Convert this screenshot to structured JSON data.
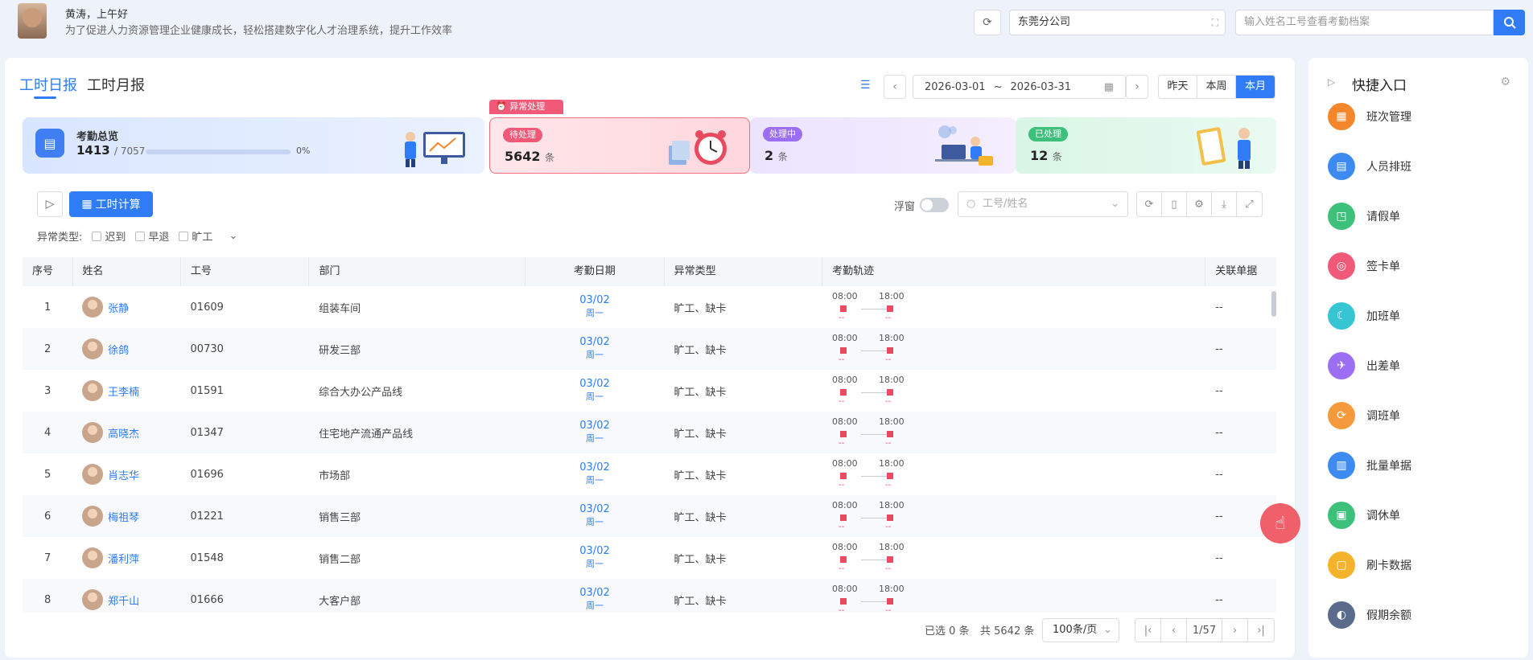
{
  "header": {
    "greeting": "黄涛，上午好",
    "slogan": "为了促进人力资源管理企业健康成长，轻松搭建数字化人才治理系统，提升工作效率",
    "company": "东莞分公司",
    "search_placeholder": "输入姓名工号查看考勤档案"
  },
  "tabs": [
    "工时日报",
    "工时月报"
  ],
  "date": {
    "start": "2026-03-01",
    "sep": "~",
    "end": "2026-03-31",
    "presets": [
      "昨天",
      "本周",
      "本月"
    ],
    "selected": "本月"
  },
  "overview": {
    "title": "考勤总览",
    "done": "1413",
    "total": "/ 7057",
    "percent": "0%",
    "progress": 0
  },
  "abnormal_tag": "异常处理",
  "status": [
    {
      "label": "待处理",
      "count": "5642",
      "unit": "条",
      "color": "#f05a78"
    },
    {
      "label": "处理中",
      "count": "2",
      "unit": "条",
      "color": "#9b6ef3"
    },
    {
      "label": "已处理",
      "count": "12",
      "unit": "条",
      "color": "#3cc07a"
    }
  ],
  "toolbar": {
    "calc": "工时计算",
    "float_label": "浮窗",
    "emp_placeholder": "工号/姓名"
  },
  "filter": {
    "label": "异常类型:",
    "options": [
      "迟到",
      "早退",
      "旷工"
    ]
  },
  "columns": [
    "序号",
    "姓名",
    "工号",
    "部门",
    "考勤日期",
    "异常类型",
    "考勤轨迹",
    "关联单据"
  ],
  "rows": [
    {
      "idx": "1",
      "name": "张静",
      "no": "01609",
      "dept": "组装车间",
      "date": "03/02",
      "week": "周一",
      "type": "旷工、缺卡",
      "in": "08:00",
      "out": "18:00",
      "miss": "--",
      "rel": "--"
    },
    {
      "idx": "2",
      "name": "徐鸽",
      "no": "00730",
      "dept": "研发三部",
      "date": "03/02",
      "week": "周一",
      "type": "旷工、缺卡",
      "in": "08:00",
      "out": "18:00",
      "miss": "--",
      "rel": "--"
    },
    {
      "idx": "3",
      "name": "王李楠",
      "no": "01591",
      "dept": "综合大办公产品线",
      "date": "03/02",
      "week": "周一",
      "type": "旷工、缺卡",
      "in": "08:00",
      "out": "18:00",
      "miss": "--",
      "rel": "--"
    },
    {
      "idx": "4",
      "name": "高晓杰",
      "no": "01347",
      "dept": "住宅地产流通产品线",
      "date": "03/02",
      "week": "周一",
      "type": "旷工、缺卡",
      "in": "08:00",
      "out": "18:00",
      "miss": "--",
      "rel": "--"
    },
    {
      "idx": "5",
      "name": "肖志华",
      "no": "01696",
      "dept": "市场部",
      "date": "03/02",
      "week": "周一",
      "type": "旷工、缺卡",
      "in": "08:00",
      "out": "18:00",
      "miss": "--",
      "rel": "--"
    },
    {
      "idx": "6",
      "name": "梅祖琴",
      "no": "01221",
      "dept": "销售三部",
      "date": "03/02",
      "week": "周一",
      "type": "旷工、缺卡",
      "in": "08:00",
      "out": "18:00",
      "miss": "--",
      "rel": "--"
    },
    {
      "idx": "7",
      "name": "潘利萍",
      "no": "01548",
      "dept": "销售二部",
      "date": "03/02",
      "week": "周一",
      "type": "旷工、缺卡",
      "in": "08:00",
      "out": "18:00",
      "miss": "--",
      "rel": "--"
    },
    {
      "idx": "8",
      "name": "郑千山",
      "no": "01666",
      "dept": "大客户部",
      "date": "03/02",
      "week": "周一",
      "type": "旷工、缺卡",
      "in": "08:00",
      "out": "18:00",
      "miss": "--",
      "rel": "--"
    }
  ],
  "footer": {
    "selected": "已选 0 条",
    "total": "共 5642 条",
    "page_size": "100条/页",
    "page": "1/57"
  },
  "quick": {
    "title": "快捷入口",
    "items": [
      {
        "label": "班次管理",
        "color": "#f5862b",
        "icon": "▦"
      },
      {
        "label": "人员排班",
        "color": "#3d8bf0",
        "icon": "▤"
      },
      {
        "label": "请假单",
        "color": "#3cc07a",
        "icon": "◳"
      },
      {
        "label": "签卡单",
        "color": "#f05a78",
        "icon": "◎"
      },
      {
        "label": "加班单",
        "color": "#36c6d3",
        "icon": "☾"
      },
      {
        "label": "出差单",
        "color": "#9b6ef3",
        "icon": "✈"
      },
      {
        "label": "调班单",
        "color": "#f59a3c",
        "icon": "⟳"
      },
      {
        "label": "批量单据",
        "color": "#3d8bf0",
        "icon": "▥"
      },
      {
        "label": "调休单",
        "color": "#3cc07a",
        "icon": "▣"
      },
      {
        "label": "刷卡数据",
        "color": "#f5b32b",
        "icon": "▢"
      },
      {
        "label": "假期余额",
        "color": "#5a6b8c",
        "icon": "◐"
      }
    ]
  }
}
